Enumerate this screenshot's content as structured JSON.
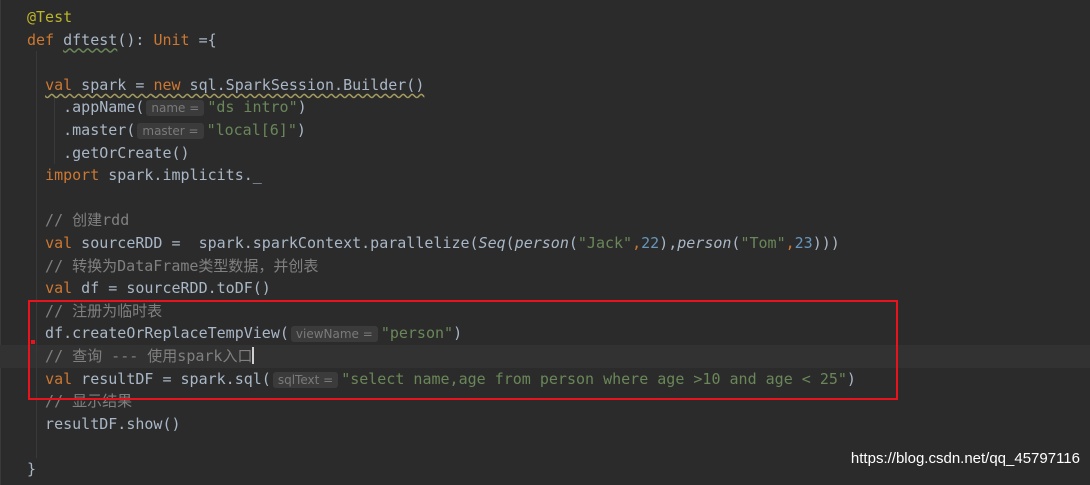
{
  "editor": {
    "colors": {
      "background": "#2b2b2b",
      "keyword": "#cc7832",
      "string": "#6a8759",
      "comment": "#808080",
      "annotation": "#bbb529",
      "number": "#6897bb",
      "text": "#a9b7c6",
      "highlight_box": "#e8141d"
    },
    "current_line": 15,
    "lines": [
      [
        [
          "@Test",
          "a"
        ]
      ],
      [
        [
          "def ",
          "k"
        ],
        [
          "dftest",
          "u"
        ],
        [
          "(): ",
          ""
        ],
        [
          "Unit",
          "k"
        ],
        [
          " ={",
          ""
        ]
      ],
      [],
      [
        [
          "  ",
          ""
        ],
        [
          "val",
          "k uw"
        ],
        [
          " spark = ",
          "uw"
        ],
        [
          "new",
          "k uw"
        ],
        [
          " sql.SparkSession.Builder()",
          "uw"
        ]
      ],
      [
        [
          "    .appName(",
          ""
        ],
        [
          "name =",
          "h"
        ],
        [
          "\"ds intro\"",
          "s"
        ],
        [
          ")",
          ""
        ]
      ],
      [
        [
          "    .master(",
          ""
        ],
        [
          "master =",
          "h"
        ],
        [
          "\"local[6]\"",
          "s"
        ],
        [
          ")",
          ""
        ]
      ],
      [
        [
          "    .getOrCreate()",
          ""
        ]
      ],
      [
        [
          "  ",
          ""
        ],
        [
          "import",
          "k"
        ],
        [
          " spark.implicits._",
          ""
        ]
      ],
      [],
      [
        [
          "  // 创建rdd",
          "c"
        ]
      ],
      [
        [
          "  ",
          ""
        ],
        [
          "val",
          "k"
        ],
        [
          " sourceRDD =  spark.sparkContext.parallelize(",
          ""
        ],
        [
          "Seq",
          "i"
        ],
        [
          "(",
          ""
        ],
        [
          "person",
          "i"
        ],
        [
          "(",
          ""
        ],
        [
          "\"Jack\"",
          "s"
        ],
        [
          ",",
          "k"
        ],
        [
          "22",
          "n"
        ],
        [
          "),",
          ""
        ],
        [
          "person",
          "i"
        ],
        [
          "(",
          ""
        ],
        [
          "\"Tom\"",
          "s"
        ],
        [
          ",",
          "k"
        ],
        [
          "23",
          "n"
        ],
        [
          ")))",
          ""
        ]
      ],
      [
        [
          "  // 转换为DataFrame类型数据，并创表",
          "c"
        ]
      ],
      [
        [
          "  ",
          ""
        ],
        [
          "val",
          "k"
        ],
        [
          " df = sourceRDD.toDF()",
          ""
        ]
      ],
      [
        [
          "  // 注册为临时表",
          "c"
        ]
      ],
      [
        [
          "  df.createOrReplaceTempView(",
          ""
        ],
        [
          "viewName =",
          "h"
        ],
        [
          "\"person\"",
          "s"
        ],
        [
          ")",
          ""
        ]
      ],
      [
        [
          "  // 查询 --- 使用spark入口",
          "c"
        ]
      ],
      [
        [
          "  ",
          ""
        ],
        [
          "val",
          "k"
        ],
        [
          " resultDF = spark.sql(",
          ""
        ],
        [
          "sqlText =",
          "h"
        ],
        [
          "\"select name,age from person where age >10 and age < 25\"",
          "s"
        ],
        [
          ")",
          ""
        ]
      ],
      [
        [
          "  // 显示结果",
          "c"
        ]
      ],
      [
        [
          "  resultDF.show()",
          ""
        ]
      ],
      [],
      [
        [
          "}",
          ""
        ]
      ]
    ]
  },
  "watermark": "https://blog.csdn.net/qq_45797116"
}
